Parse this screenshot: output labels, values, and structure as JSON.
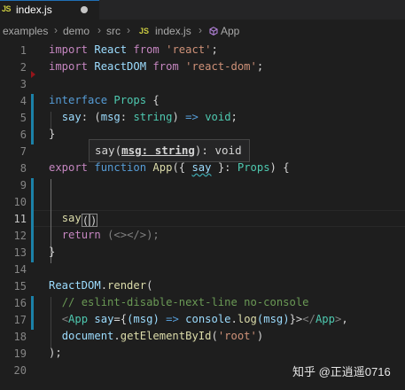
{
  "tab": {
    "icon": "JS",
    "title": "index.js"
  },
  "breadcrumb": {
    "items": [
      "examples",
      "demo",
      "src",
      "index.js",
      "App"
    ],
    "file_icon": "JS",
    "symbol_icon": "cube-icon"
  },
  "line_numbers": [
    "1",
    "2",
    "3",
    "4",
    "5",
    "6",
    "7",
    "8",
    "9",
    "10",
    "11",
    "12",
    "13",
    "14",
    "15",
    "16",
    "17",
    "18",
    "19",
    "20"
  ],
  "code": {
    "l1": {
      "kw": "import",
      "name": "React",
      "from": "from",
      "str": "'react'",
      "end": ";"
    },
    "l2": {
      "kw": "import",
      "name": "ReactDOM",
      "from": "from",
      "str": "'react-dom'",
      "end": ";"
    },
    "l4": {
      "kw": "interface",
      "type": "Props",
      "brace": "{"
    },
    "l5": {
      "prop": "say",
      "colon": ":",
      "open": "(",
      "param": "msg",
      "colon2": ":",
      "ptype": "string",
      "close": ")",
      "arrow": "=>",
      "ret": "void",
      "end": ";"
    },
    "l6": {
      "brace": "}"
    },
    "l8": {
      "export": "export",
      "function": "function",
      "name": "App",
      "open": "({",
      "prop": "say",
      "close": "}:",
      "type": "Props",
      "end": ") {"
    },
    "l11": {
      "call": "say",
      "parens": "(",
      "close_paren": ")"
    },
    "l12": {
      "kw": "return",
      "rest": "(<></>);"
    },
    "l13": {
      "brace": "}"
    },
    "l15": {
      "obj": "ReactDOM",
      "dot": ".",
      "method": "render",
      "open": "("
    },
    "l16": {
      "comment": "// eslint-disable-next-line no-console"
    },
    "l17": {
      "lt": "<",
      "comp": "App",
      "attr": "say",
      "eq": "={",
      "param": "(msg)",
      "arrow": "=>",
      "console": "console",
      "dot": ".",
      "log": "log",
      "args": "(msg)",
      "close": "}>",
      "endtag_open": "</",
      "endcomp": "App",
      "endtag_close": ">",
      "comma": ","
    },
    "l18": {
      "obj": "document",
      "dot": ".",
      "method": "getElementById",
      "open": "(",
      "str": "'root'",
      "close": ")"
    },
    "l19": {
      "end": ");"
    }
  },
  "hover": {
    "fn": "say",
    "open": "(",
    "param": "msg: string",
    "close": "):",
    "ret": "void"
  },
  "watermark": "知乎 @正逍遥0716"
}
